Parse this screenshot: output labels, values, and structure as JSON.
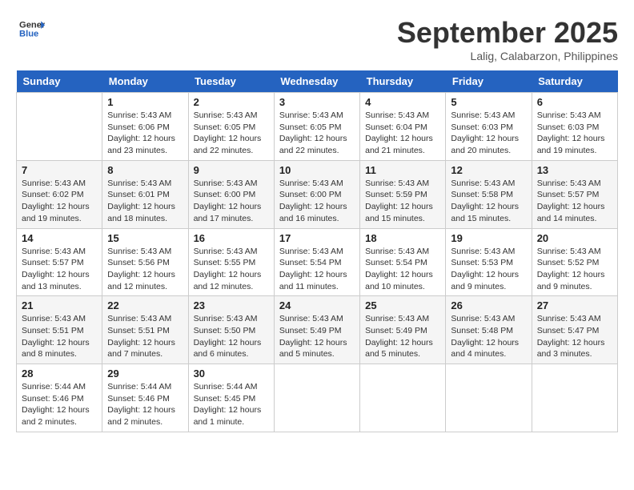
{
  "header": {
    "logo_line1": "General",
    "logo_line2": "Blue",
    "month": "September 2025",
    "location": "Lalig, Calabarzon, Philippines"
  },
  "days_of_week": [
    "Sunday",
    "Monday",
    "Tuesday",
    "Wednesday",
    "Thursday",
    "Friday",
    "Saturday"
  ],
  "weeks": [
    [
      {
        "day": "",
        "info": ""
      },
      {
        "day": "1",
        "info": "Sunrise: 5:43 AM\nSunset: 6:06 PM\nDaylight: 12 hours\nand 23 minutes."
      },
      {
        "day": "2",
        "info": "Sunrise: 5:43 AM\nSunset: 6:05 PM\nDaylight: 12 hours\nand 22 minutes."
      },
      {
        "day": "3",
        "info": "Sunrise: 5:43 AM\nSunset: 6:05 PM\nDaylight: 12 hours\nand 22 minutes."
      },
      {
        "day": "4",
        "info": "Sunrise: 5:43 AM\nSunset: 6:04 PM\nDaylight: 12 hours\nand 21 minutes."
      },
      {
        "day": "5",
        "info": "Sunrise: 5:43 AM\nSunset: 6:03 PM\nDaylight: 12 hours\nand 20 minutes."
      },
      {
        "day": "6",
        "info": "Sunrise: 5:43 AM\nSunset: 6:03 PM\nDaylight: 12 hours\nand 19 minutes."
      }
    ],
    [
      {
        "day": "7",
        "info": "Sunrise: 5:43 AM\nSunset: 6:02 PM\nDaylight: 12 hours\nand 19 minutes."
      },
      {
        "day": "8",
        "info": "Sunrise: 5:43 AM\nSunset: 6:01 PM\nDaylight: 12 hours\nand 18 minutes."
      },
      {
        "day": "9",
        "info": "Sunrise: 5:43 AM\nSunset: 6:00 PM\nDaylight: 12 hours\nand 17 minutes."
      },
      {
        "day": "10",
        "info": "Sunrise: 5:43 AM\nSunset: 6:00 PM\nDaylight: 12 hours\nand 16 minutes."
      },
      {
        "day": "11",
        "info": "Sunrise: 5:43 AM\nSunset: 5:59 PM\nDaylight: 12 hours\nand 15 minutes."
      },
      {
        "day": "12",
        "info": "Sunrise: 5:43 AM\nSunset: 5:58 PM\nDaylight: 12 hours\nand 15 minutes."
      },
      {
        "day": "13",
        "info": "Sunrise: 5:43 AM\nSunset: 5:57 PM\nDaylight: 12 hours\nand 14 minutes."
      }
    ],
    [
      {
        "day": "14",
        "info": "Sunrise: 5:43 AM\nSunset: 5:57 PM\nDaylight: 12 hours\nand 13 minutes."
      },
      {
        "day": "15",
        "info": "Sunrise: 5:43 AM\nSunset: 5:56 PM\nDaylight: 12 hours\nand 12 minutes."
      },
      {
        "day": "16",
        "info": "Sunrise: 5:43 AM\nSunset: 5:55 PM\nDaylight: 12 hours\nand 12 minutes."
      },
      {
        "day": "17",
        "info": "Sunrise: 5:43 AM\nSunset: 5:54 PM\nDaylight: 12 hours\nand 11 minutes."
      },
      {
        "day": "18",
        "info": "Sunrise: 5:43 AM\nSunset: 5:54 PM\nDaylight: 12 hours\nand 10 minutes."
      },
      {
        "day": "19",
        "info": "Sunrise: 5:43 AM\nSunset: 5:53 PM\nDaylight: 12 hours\nand 9 minutes."
      },
      {
        "day": "20",
        "info": "Sunrise: 5:43 AM\nSunset: 5:52 PM\nDaylight: 12 hours\nand 9 minutes."
      }
    ],
    [
      {
        "day": "21",
        "info": "Sunrise: 5:43 AM\nSunset: 5:51 PM\nDaylight: 12 hours\nand 8 minutes."
      },
      {
        "day": "22",
        "info": "Sunrise: 5:43 AM\nSunset: 5:51 PM\nDaylight: 12 hours\nand 7 minutes."
      },
      {
        "day": "23",
        "info": "Sunrise: 5:43 AM\nSunset: 5:50 PM\nDaylight: 12 hours\nand 6 minutes."
      },
      {
        "day": "24",
        "info": "Sunrise: 5:43 AM\nSunset: 5:49 PM\nDaylight: 12 hours\nand 5 minutes."
      },
      {
        "day": "25",
        "info": "Sunrise: 5:43 AM\nSunset: 5:49 PM\nDaylight: 12 hours\nand 5 minutes."
      },
      {
        "day": "26",
        "info": "Sunrise: 5:43 AM\nSunset: 5:48 PM\nDaylight: 12 hours\nand 4 minutes."
      },
      {
        "day": "27",
        "info": "Sunrise: 5:43 AM\nSunset: 5:47 PM\nDaylight: 12 hours\nand 3 minutes."
      }
    ],
    [
      {
        "day": "28",
        "info": "Sunrise: 5:44 AM\nSunset: 5:46 PM\nDaylight: 12 hours\nand 2 minutes."
      },
      {
        "day": "29",
        "info": "Sunrise: 5:44 AM\nSunset: 5:46 PM\nDaylight: 12 hours\nand 2 minutes."
      },
      {
        "day": "30",
        "info": "Sunrise: 5:44 AM\nSunset: 5:45 PM\nDaylight: 12 hours\nand 1 minute."
      },
      {
        "day": "",
        "info": ""
      },
      {
        "day": "",
        "info": ""
      },
      {
        "day": "",
        "info": ""
      },
      {
        "day": "",
        "info": ""
      }
    ]
  ]
}
